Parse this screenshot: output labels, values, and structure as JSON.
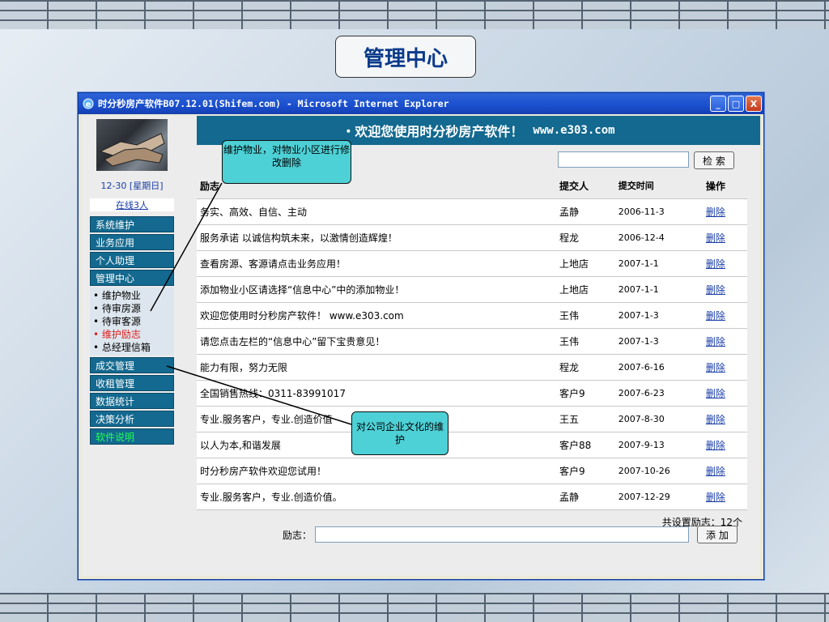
{
  "slide_title": "管理中心",
  "window": {
    "title": "时分秒房产软件B07.12.01(Shifem.com) - Microsoft Internet Explorer",
    "buttons": [
      "_",
      "□",
      "X"
    ]
  },
  "sidebar": {
    "date": "12-30 [星期日]",
    "online": "在线3人",
    "menu": [
      "系统维护",
      "业务应用",
      "个人助理",
      "管理中心"
    ],
    "sub_items": [
      "维护物业",
      "待审房源",
      "待审客源",
      "维护励志",
      "总经理信箱"
    ],
    "menu_after": [
      "成交管理",
      "收租管理",
      "数据统计",
      "决策分析"
    ],
    "help": "软件说明"
  },
  "main": {
    "welcome": "・欢迎您使用时分秒房产软件！",
    "welcome_url": "www.e303.com",
    "search_button": "检 索",
    "headers": [
      "励志",
      "提交人",
      "提交时间",
      "操作"
    ],
    "rows": [
      [
        "务实、高效、自信、主动",
        "孟静",
        "2006-11-3",
        "删除"
      ],
      [
        "服务承诺 以诚信构筑未来，以激情创造辉煌！",
        "程龙",
        "2006-12-4",
        "删除"
      ],
      [
        "查看房源、客源请点击业务应用！",
        "上地店",
        "2007-1-1",
        "删除"
      ],
      [
        "添加物业小区请选择“信息中心”中的添加物业！",
        "上地店",
        "2007-1-1",
        "删除"
      ],
      [
        "欢迎您使用时分秒房产软件！ www.e303.com",
        "王伟",
        "2007-1-3",
        "删除"
      ],
      [
        "请您点击左栏的“信息中心”留下宝贵意见！",
        "王伟",
        "2007-1-3",
        "删除"
      ],
      [
        "能力有限，努力无限",
        "程龙",
        "2007-6-16",
        "删除"
      ],
      [
        "全国销售热线：0311-83991017",
        "客户9",
        "2007-6-23",
        "删除"
      ],
      [
        "专业.服务客户，专业.创造价值",
        "王五",
        "2007-8-30",
        "删除"
      ],
      [
        "以人为本,和谐发展",
        "客户88",
        "2007-9-13",
        "删除"
      ],
      [
        "时分秒房产软件欢迎您试用！",
        "客户9",
        "2007-10-26",
        "删除"
      ],
      [
        "专业.服务客户，专业.创造价值。",
        "孟静",
        "2007-12-29",
        "删除"
      ]
    ],
    "total": "共设置励志：12个",
    "add_label": "励志：",
    "add_button": "添 加"
  },
  "callouts": {
    "top": "维护物业，对物业小区进行修改删除",
    "bottom": "对公司企业文化的维护"
  }
}
